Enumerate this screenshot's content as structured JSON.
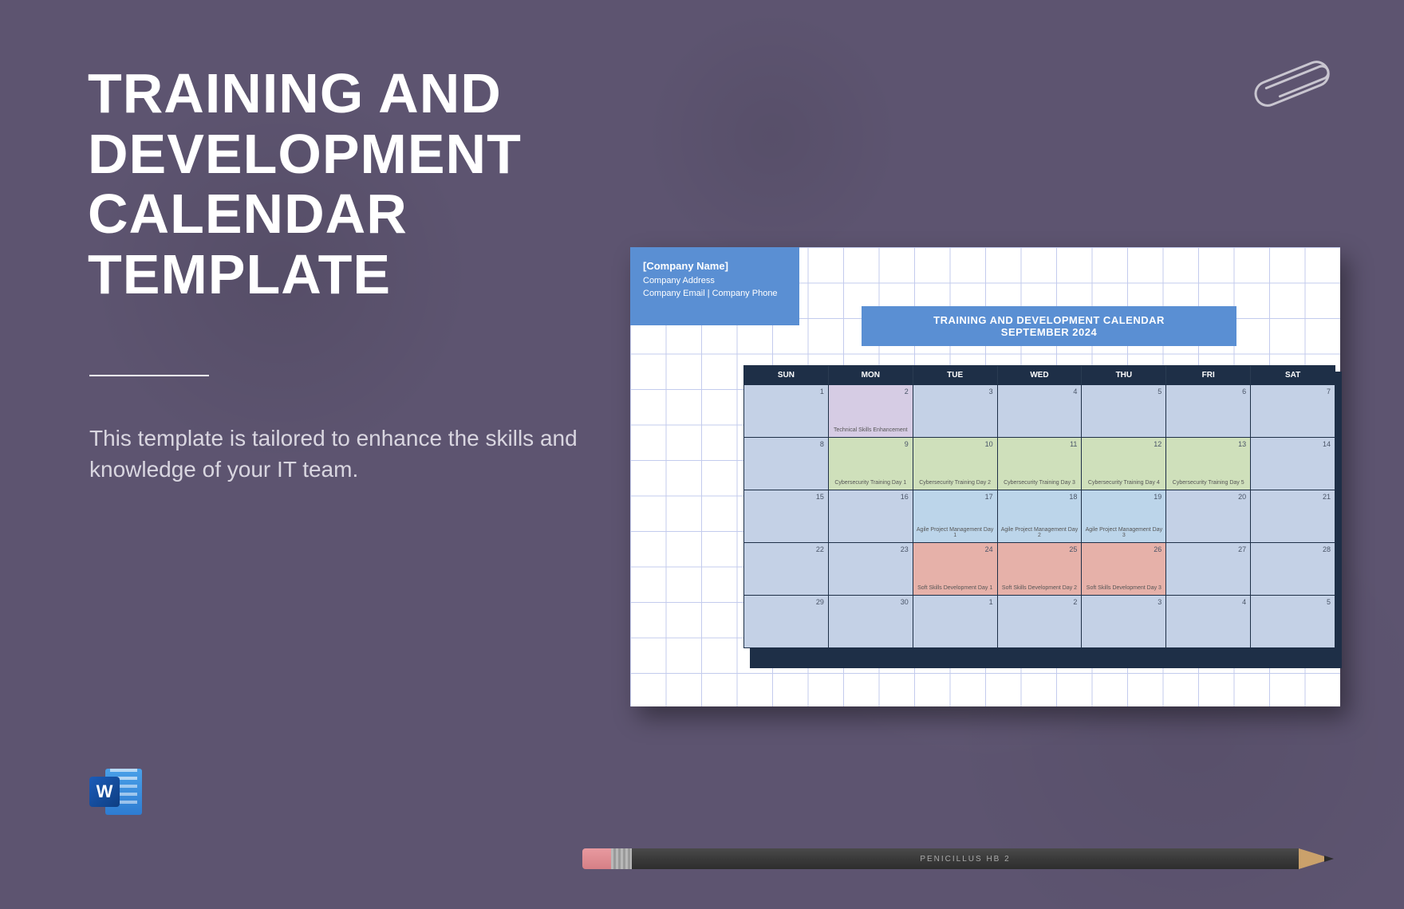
{
  "hero": {
    "title": "TRAINING AND\nDEVELOPMENT\nCALENDAR\nTEMPLATE",
    "subtitle": "This template is tailored to enhance the skills and knowledge of your IT team."
  },
  "word_icon": {
    "letter": "W"
  },
  "pencil": {
    "label": "PENICILLUS   HB 2"
  },
  "preview": {
    "company": {
      "name": "[Company Name]",
      "address": "Company Address",
      "contact": "Company Email | Company Phone"
    },
    "banner": {
      "line1": "TRAINING AND DEVELOPMENT CALENDAR",
      "line2": "SEPTEMBER 2024"
    },
    "days": [
      "SUN",
      "MON",
      "TUE",
      "WED",
      "THU",
      "FRI",
      "SAT"
    ],
    "weeks": [
      [
        {
          "n": "1"
        },
        {
          "n": "2",
          "evt": "Technical Skills Enhancement",
          "cls": "evt-purple"
        },
        {
          "n": "3"
        },
        {
          "n": "4"
        },
        {
          "n": "5"
        },
        {
          "n": "6"
        },
        {
          "n": "7"
        }
      ],
      [
        {
          "n": "8"
        },
        {
          "n": "9",
          "evt": "Cybersecurity Training Day 1",
          "cls": "evt-green"
        },
        {
          "n": "10",
          "evt": "Cybersecurity Training Day 2",
          "cls": "evt-green"
        },
        {
          "n": "11",
          "evt": "Cybersecurity Training Day 3",
          "cls": "evt-green"
        },
        {
          "n": "12",
          "evt": "Cybersecurity Training Day 4",
          "cls": "evt-green"
        },
        {
          "n": "13",
          "evt": "Cybersecurity Training Day 5",
          "cls": "evt-green"
        },
        {
          "n": "14"
        }
      ],
      [
        {
          "n": "15"
        },
        {
          "n": "16"
        },
        {
          "n": "17",
          "evt": "Agile Project Management Day 1",
          "cls": "evt-blue"
        },
        {
          "n": "18",
          "evt": "Agile Project Management Day 2",
          "cls": "evt-blue"
        },
        {
          "n": "19",
          "evt": "Agile Project Management Day 3",
          "cls": "evt-blue"
        },
        {
          "n": "20"
        },
        {
          "n": "21"
        }
      ],
      [
        {
          "n": "22"
        },
        {
          "n": "23"
        },
        {
          "n": "24",
          "evt": "Soft Skills Development Day 1",
          "cls": "evt-red"
        },
        {
          "n": "25",
          "evt": "Soft Skills Development Day 2",
          "cls": "evt-red"
        },
        {
          "n": "26",
          "evt": "Soft Skills Development Day 3",
          "cls": "evt-red"
        },
        {
          "n": "27"
        },
        {
          "n": "28"
        }
      ],
      [
        {
          "n": "29"
        },
        {
          "n": "30"
        },
        {
          "n": "1"
        },
        {
          "n": "2"
        },
        {
          "n": "3"
        },
        {
          "n": "4"
        },
        {
          "n": "5"
        }
      ]
    ]
  }
}
